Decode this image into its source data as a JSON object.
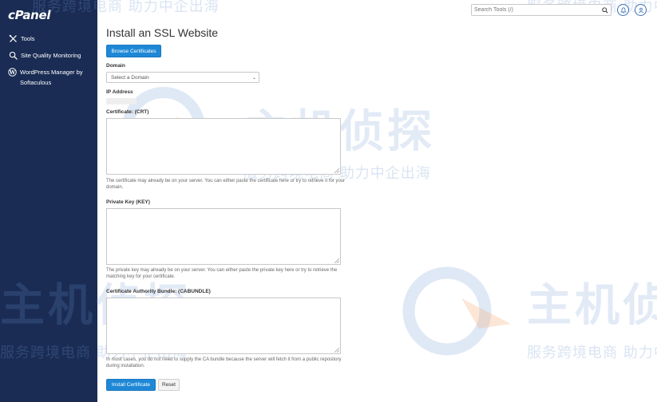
{
  "sidebar": {
    "logo": "cPanel",
    "items": [
      {
        "label": "Tools",
        "icon": "tools-icon"
      },
      {
        "label": "Site Quality Monitoring",
        "icon": "magnifier-icon"
      },
      {
        "label": "WordPress Manager by Softaculous",
        "icon": "wordpress-icon"
      }
    ]
  },
  "header": {
    "search_placeholder": "Search Tools (/)"
  },
  "main": {
    "title": "Install an SSL Website",
    "browse_label": "Browse Certificates",
    "domain": {
      "label": "Domain",
      "selected": "Select a Domain"
    },
    "ip": {
      "label": "IP Address"
    },
    "certificate": {
      "label": "Certificate: (CRT)",
      "help": "The certificate may already be on your server. You can either paste the certificate here or try to retrieve it for your domain."
    },
    "private_key": {
      "label": "Private Key (KEY)",
      "help": "The private key may already be on your server. You can either paste the private key here or try to retrieve the matching key for your certificate."
    },
    "cabundle": {
      "label": "Certificate Authority Bundle: (CABUNDLE)",
      "help": "In most cases, you do not need to supply the CA bundle because the server will fetch it from a public repository during installation."
    },
    "install_label": "Install Certificate",
    "reset_label": "Reset"
  },
  "watermark": {
    "brand": "主机侦探",
    "slogan": "服务跨境电商 助力中企出海"
  },
  "colors": {
    "sidebar_bg": "#1a2c54",
    "primary": "#1e88d6",
    "header_icon": "#3d6fb5"
  }
}
